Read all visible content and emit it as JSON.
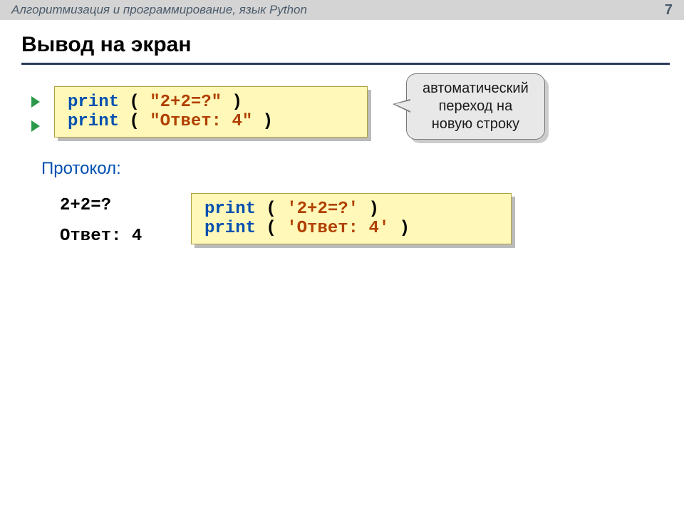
{
  "header": {
    "title": "Алгоритмизация и программирование, язык Python",
    "page": "7"
  },
  "slide_title": "Вывод на экран",
  "callout": {
    "line1": "автоматический",
    "line2": "переход на",
    "line3": "новую строку"
  },
  "code1": {
    "line1": {
      "kw": "print",
      "paren1": " ( ",
      "str": "\"2+2=?\"",
      "paren2": " )"
    },
    "line2": {
      "kw": "print",
      "paren1": " ( ",
      "str": "\"Ответ: 4\"",
      "paren2": " )"
    }
  },
  "protocol": {
    "label": "Протокол:",
    "line1": "2+2=?",
    "line2": "Ответ: 4"
  },
  "code2": {
    "line1": {
      "kw": "print",
      "paren1": " ( ",
      "str": "'2+2=?'",
      "paren2": " )"
    },
    "line2": {
      "kw": "print",
      "paren1": " ( ",
      "str": "'Ответ: 4'",
      "paren2": " )"
    }
  }
}
